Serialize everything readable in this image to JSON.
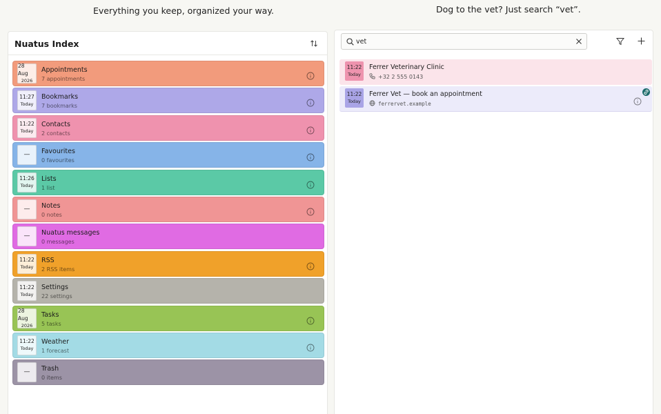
{
  "captions": {
    "left": "Everything you keep, organized your way.",
    "right": "Dog to the vet? Just search “vet”."
  },
  "index": {
    "title": "Nuatus Index",
    "sort_icon": "sort-arrows-icon",
    "items": [
      {
        "name": "Appointments",
        "sub": "7 appointments",
        "stamp1": "28 Aug",
        "stamp2": "2026",
        "color": "#f29b7c",
        "has_info": true
      },
      {
        "name": "Bookmarks",
        "sub": "7 bookmarks",
        "stamp1": "11:27",
        "stamp2": "Today",
        "color": "#aea8e8",
        "has_info": true
      },
      {
        "name": "Contacts",
        "sub": "2 contacts",
        "stamp1": "11:22",
        "stamp2": "Today",
        "color": "#ef92ae",
        "has_info": true
      },
      {
        "name": "Favourites",
        "sub": "0 favourites",
        "stamp1": "—",
        "stamp2": "",
        "color": "#86b4e8",
        "has_info": true
      },
      {
        "name": "Lists",
        "sub": "1 list",
        "stamp1": "11:26",
        "stamp2": "Today",
        "color": "#5bc9a6",
        "has_info": true
      },
      {
        "name": "Notes",
        "sub": "0 notes",
        "stamp1": "—",
        "stamp2": "",
        "color": "#f09595",
        "has_info": true
      },
      {
        "name": "Nuatus messages",
        "sub": "0 messages",
        "stamp1": "—",
        "stamp2": "",
        "color": "#e06be3",
        "has_info": false
      },
      {
        "name": "RSS",
        "sub": "2 RSS items",
        "stamp1": "11:22",
        "stamp2": "Today",
        "color": "#f0a12a",
        "has_info": true
      },
      {
        "name": "Settings",
        "sub": "22 settings",
        "stamp1": "11:22",
        "stamp2": "Today",
        "color": "#b5b3ab",
        "has_info": false
      },
      {
        "name": "Tasks",
        "sub": "5 tasks",
        "stamp1": "28 Aug",
        "stamp2": "2026",
        "color": "#98c455",
        "has_info": true
      },
      {
        "name": "Weather",
        "sub": "1 forecast",
        "stamp1": "11:22",
        "stamp2": "Today",
        "color": "#a3dbe5",
        "has_info": true
      },
      {
        "name": "Trash",
        "sub": "0 items",
        "stamp1": "—",
        "stamp2": "",
        "color": "#9c93a6",
        "has_info": false
      }
    ]
  },
  "search": {
    "value": "vet",
    "placeholder": "",
    "icons": {
      "search": "search-icon",
      "clear": "close-icon",
      "filter": "filter-icon",
      "add": "plus-icon"
    }
  },
  "results": [
    {
      "name": "Ferrer Veterinary Clinic",
      "sub": "+32 2 555 0143",
      "sub_icon": "phone-icon",
      "stamp1": "11:22",
      "stamp2": "Today"
    },
    {
      "name": "Ferrer Vet — book an appointment",
      "sub": "ferrervet.example",
      "sub_icon": "globe-icon",
      "stamp1": "11:22",
      "stamp2": "Today"
    }
  ]
}
